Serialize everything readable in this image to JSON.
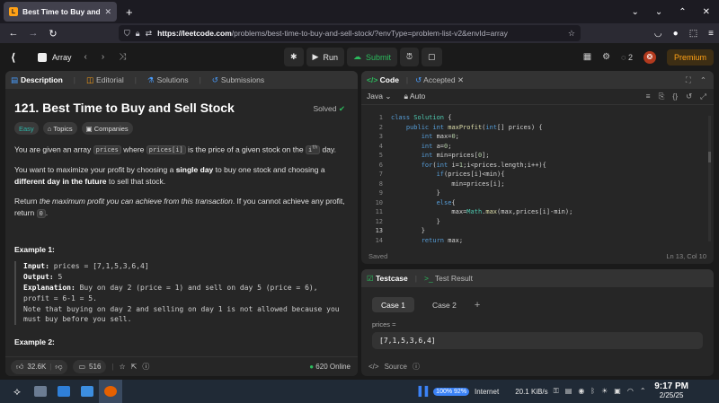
{
  "browser": {
    "tab_title": "Best Time to Buy and Sell",
    "url_host": "https://leetcode.com",
    "url_path": "/problems/best-time-to-buy-and-sell-stock/?envType=problem-list-v2&envId=array"
  },
  "header": {
    "problem_list": "Array",
    "run_label": "Run",
    "submit_label": "Submit",
    "streak": "2",
    "premium_label": "Premium"
  },
  "left_tabs": [
    "Description",
    "Editorial",
    "Solutions",
    "Submissions"
  ],
  "problem": {
    "title": "121. Best Time to Buy and Sell Stock",
    "status": "Solved",
    "difficulty": "Easy",
    "chips": [
      "Topics",
      "Companies"
    ],
    "p1_a": "You are given an array ",
    "p1_code1": "prices",
    "p1_b": " where ",
    "p1_code2": "prices[i]",
    "p1_c": " is the price of a given stock on the ",
    "p1_code3": "i",
    "p1_sup": "th",
    "p1_d": " day.",
    "p2_a": "You want to maximize your profit by choosing a ",
    "p2_b1": "single day",
    "p2_c": " to buy one stock and choosing a ",
    "p2_b2": "different day in the future",
    "p2_d": " to sell that stock.",
    "p3_a": "Return ",
    "p3_i": "the maximum profit you can achieve from this transaction",
    "p3_b": ". If you cannot achieve any profit, return ",
    "p3_code": "0",
    "p3_c": ".",
    "example1_title": "Example 1:",
    "ex1_input_label": "Input:",
    "ex1_input": " prices = [7,1,5,3,6,4]",
    "ex1_output_label": "Output:",
    "ex1_output": " 5",
    "ex1_expl_label": "Explanation:",
    "ex1_expl": " Buy on day 2 (price = 1) and sell on day 5 (price = 6),",
    "ex1_expl2": "profit = 6-1 = 5.",
    "ex1_note1": "Note that buying on day 2 and selling on day 1 is not allowed because you",
    "ex1_note2": "must buy before you sell.",
    "example2_title": "Example 2:"
  },
  "left_footer": {
    "likes": "32.6K",
    "comments": "516",
    "online": "620 Online"
  },
  "code_tabs": [
    "Code",
    "Accepted"
  ],
  "code_toolbar": {
    "language": "Java",
    "mode": "Auto"
  },
  "code_lines": [
    {
      "n": "1",
      "t": "class Solution {"
    },
    {
      "n": "2",
      "t": "    public int maxProfit(int[] prices) {"
    },
    {
      "n": "3",
      "t": "        int max=0;"
    },
    {
      "n": "4",
      "t": "        int a=0;"
    },
    {
      "n": "5",
      "t": "        int min=prices[0];"
    },
    {
      "n": "6",
      "t": "        for(int i=1;i<prices.length;i++){"
    },
    {
      "n": "7",
      "t": "            if(prices[i]<min){"
    },
    {
      "n": "8",
      "t": "                min=prices[i];"
    },
    {
      "n": "9",
      "t": "            }"
    },
    {
      "n": "10",
      "t": "            else{"
    },
    {
      "n": "11",
      "t": "                max=Math.max(max,prices[i]-min);"
    },
    {
      "n": "12",
      "t": "            }"
    },
    {
      "n": "13",
      "t": "        }"
    },
    {
      "n": "14",
      "t": "        return max;"
    }
  ],
  "code_footer": {
    "status": "Saved",
    "position": "Ln 13, Col 10"
  },
  "test_tabs": [
    "Testcase",
    "Test Result"
  ],
  "test_cases": [
    "Case 1",
    "Case 2"
  ],
  "test_input_label": "prices =",
  "test_input_value": "[7,1,5,3,6,4]",
  "test_source": "Source",
  "taskbar": {
    "battery": "92%",
    "battery_pre": "100%",
    "network": "Internet",
    "speed": "20.1 KiB/s",
    "time": "9:17 PM",
    "date": "2/25/25"
  }
}
